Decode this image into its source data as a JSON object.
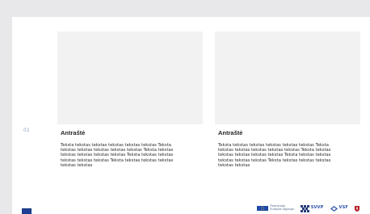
{
  "slide": {
    "number": "01",
    "cards": [
      {
        "title": "Antraštė",
        "body": "Teksta tekstas tekstas tekstas tekstas tekstas Teksta tekstas tekstas tekstas tekstas tekstas Teksta tekstas tekstas tekstas tekstas tekstas Teksta tekstas tekstas tekstas tekstas tekstas Teksta tekstas tekstas tekstas tekstas tekstas"
      },
      {
        "title": "Antraštė",
        "body": "Teksta tekstas tekstas tekstas tekstas tekstas Teksta tekstas tekstas tekstas tekstas tekstas Teksta tekstas tekstas tekstas tekstas tekstas Teksta tekstas tekstas tekstas tekstas tekstas Teksta tekstas tekstas tekstas tekstas tekstas"
      }
    ]
  },
  "footer": {
    "logos": [
      {
        "name": "eu-funds-logo",
        "text": "Finansuoja\nEuropos Sąjunga"
      },
      {
        "name": "svvp-logo",
        "text": "SVVP"
      },
      {
        "name": "vsf-logo",
        "text": "VSF"
      },
      {
        "name": "lithuania-coat-of-arms-logo",
        "text": ""
      }
    ]
  },
  "colors": {
    "page_bg": "#e8e8ea",
    "slide_bg": "#ffffff",
    "placeholder": "#f2f2f3",
    "accent": "#2a4fa8",
    "slide_number": "#8fa3c4"
  }
}
